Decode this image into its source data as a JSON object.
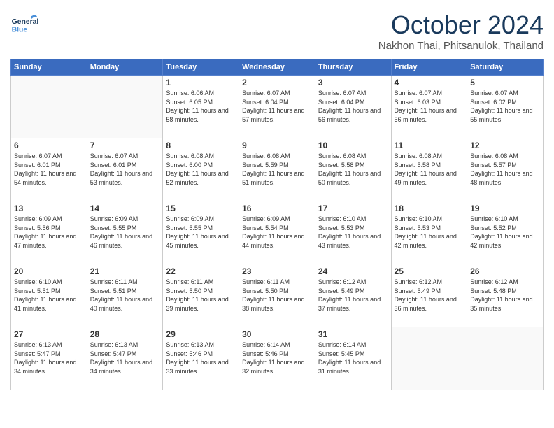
{
  "header": {
    "logo_general": "General",
    "logo_blue": "Blue",
    "month": "October 2024",
    "location": "Nakhon Thai, Phitsanulok, Thailand"
  },
  "days_of_week": [
    "Sunday",
    "Monday",
    "Tuesday",
    "Wednesday",
    "Thursday",
    "Friday",
    "Saturday"
  ],
  "weeks": [
    [
      {
        "day": "",
        "info": ""
      },
      {
        "day": "",
        "info": ""
      },
      {
        "day": "1",
        "sunrise": "6:06 AM",
        "sunset": "6:05 PM",
        "daylight": "11 hours and 58 minutes."
      },
      {
        "day": "2",
        "sunrise": "6:07 AM",
        "sunset": "6:04 PM",
        "daylight": "11 hours and 57 minutes."
      },
      {
        "day": "3",
        "sunrise": "6:07 AM",
        "sunset": "6:04 PM",
        "daylight": "11 hours and 56 minutes."
      },
      {
        "day": "4",
        "sunrise": "6:07 AM",
        "sunset": "6:03 PM",
        "daylight": "11 hours and 56 minutes."
      },
      {
        "day": "5",
        "sunrise": "6:07 AM",
        "sunset": "6:02 PM",
        "daylight": "11 hours and 55 minutes."
      }
    ],
    [
      {
        "day": "6",
        "sunrise": "6:07 AM",
        "sunset": "6:01 PM",
        "daylight": "11 hours and 54 minutes."
      },
      {
        "day": "7",
        "sunrise": "6:07 AM",
        "sunset": "6:01 PM",
        "daylight": "11 hours and 53 minutes."
      },
      {
        "day": "8",
        "sunrise": "6:08 AM",
        "sunset": "6:00 PM",
        "daylight": "11 hours and 52 minutes."
      },
      {
        "day": "9",
        "sunrise": "6:08 AM",
        "sunset": "5:59 PM",
        "daylight": "11 hours and 51 minutes."
      },
      {
        "day": "10",
        "sunrise": "6:08 AM",
        "sunset": "5:58 PM",
        "daylight": "11 hours and 50 minutes."
      },
      {
        "day": "11",
        "sunrise": "6:08 AM",
        "sunset": "5:58 PM",
        "daylight": "11 hours and 49 minutes."
      },
      {
        "day": "12",
        "sunrise": "6:08 AM",
        "sunset": "5:57 PM",
        "daylight": "11 hours and 48 minutes."
      }
    ],
    [
      {
        "day": "13",
        "sunrise": "6:09 AM",
        "sunset": "5:56 PM",
        "daylight": "11 hours and 47 minutes."
      },
      {
        "day": "14",
        "sunrise": "6:09 AM",
        "sunset": "5:55 PM",
        "daylight": "11 hours and 46 minutes."
      },
      {
        "day": "15",
        "sunrise": "6:09 AM",
        "sunset": "5:55 PM",
        "daylight": "11 hours and 45 minutes."
      },
      {
        "day": "16",
        "sunrise": "6:09 AM",
        "sunset": "5:54 PM",
        "daylight": "11 hours and 44 minutes."
      },
      {
        "day": "17",
        "sunrise": "6:10 AM",
        "sunset": "5:53 PM",
        "daylight": "11 hours and 43 minutes."
      },
      {
        "day": "18",
        "sunrise": "6:10 AM",
        "sunset": "5:53 PM",
        "daylight": "11 hours and 42 minutes."
      },
      {
        "day": "19",
        "sunrise": "6:10 AM",
        "sunset": "5:52 PM",
        "daylight": "11 hours and 42 minutes."
      }
    ],
    [
      {
        "day": "20",
        "sunrise": "6:10 AM",
        "sunset": "5:51 PM",
        "daylight": "11 hours and 41 minutes."
      },
      {
        "day": "21",
        "sunrise": "6:11 AM",
        "sunset": "5:51 PM",
        "daylight": "11 hours and 40 minutes."
      },
      {
        "day": "22",
        "sunrise": "6:11 AM",
        "sunset": "5:50 PM",
        "daylight": "11 hours and 39 minutes."
      },
      {
        "day": "23",
        "sunrise": "6:11 AM",
        "sunset": "5:50 PM",
        "daylight": "11 hours and 38 minutes."
      },
      {
        "day": "24",
        "sunrise": "6:12 AM",
        "sunset": "5:49 PM",
        "daylight": "11 hours and 37 minutes."
      },
      {
        "day": "25",
        "sunrise": "6:12 AM",
        "sunset": "5:49 PM",
        "daylight": "11 hours and 36 minutes."
      },
      {
        "day": "26",
        "sunrise": "6:12 AM",
        "sunset": "5:48 PM",
        "daylight": "11 hours and 35 minutes."
      }
    ],
    [
      {
        "day": "27",
        "sunrise": "6:13 AM",
        "sunset": "5:47 PM",
        "daylight": "11 hours and 34 minutes."
      },
      {
        "day": "28",
        "sunrise": "6:13 AM",
        "sunset": "5:47 PM",
        "daylight": "11 hours and 34 minutes."
      },
      {
        "day": "29",
        "sunrise": "6:13 AM",
        "sunset": "5:46 PM",
        "daylight": "11 hours and 33 minutes."
      },
      {
        "day": "30",
        "sunrise": "6:14 AM",
        "sunset": "5:46 PM",
        "daylight": "11 hours and 32 minutes."
      },
      {
        "day": "31",
        "sunrise": "6:14 AM",
        "sunset": "5:45 PM",
        "daylight": "11 hours and 31 minutes."
      },
      {
        "day": "",
        "info": ""
      },
      {
        "day": "",
        "info": ""
      }
    ]
  ],
  "labels": {
    "sunrise": "Sunrise: ",
    "sunset": "Sunset: ",
    "daylight": "Daylight: "
  }
}
